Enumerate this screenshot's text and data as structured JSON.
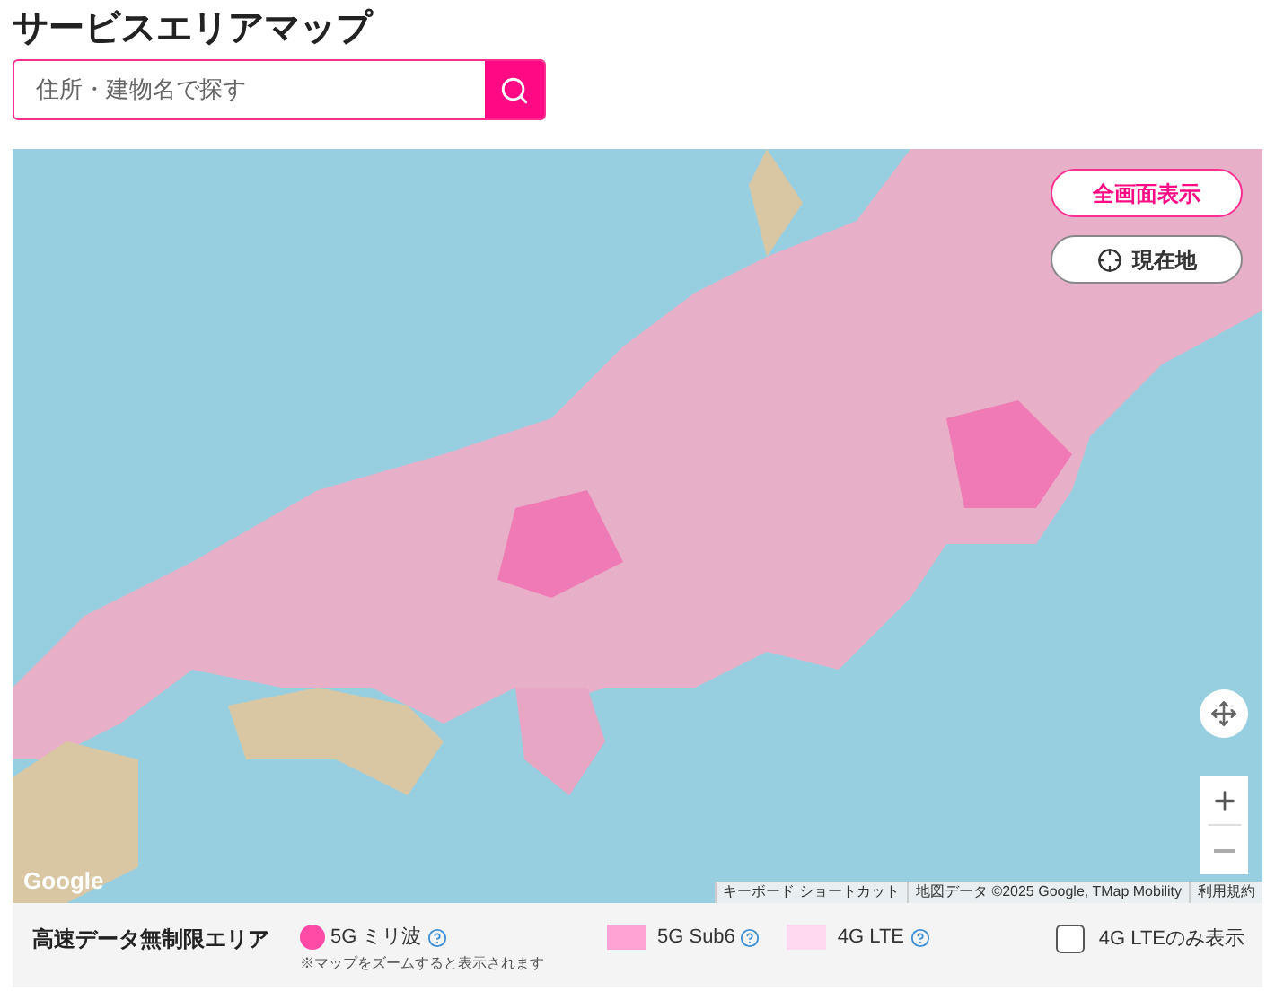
{
  "title": "サービスエリアマップ",
  "search": {
    "placeholder": "住所・建物名で探す"
  },
  "map": {
    "fullscreen_button": "全画面表示",
    "location_button": "現在地",
    "logo": "Google",
    "attribution": [
      "キーボード ショートカット",
      "地図データ ©2025 Google, TMap Mobility",
      "利用規約"
    ]
  },
  "legend": {
    "title": "高速データ無制限エリア",
    "items": [
      {
        "kind": "dot",
        "label": "5G ミリ波",
        "color": "#ff4aa6",
        "note": "※マップをズームすると表示されます"
      },
      {
        "kind": "square",
        "label": "5G Sub6",
        "color": "#ffa3d4"
      },
      {
        "kind": "square",
        "label": "4G LTE",
        "color": "#ffd9ef"
      }
    ],
    "filter": {
      "label": "4G LTEのみ表示",
      "checked": false
    }
  }
}
